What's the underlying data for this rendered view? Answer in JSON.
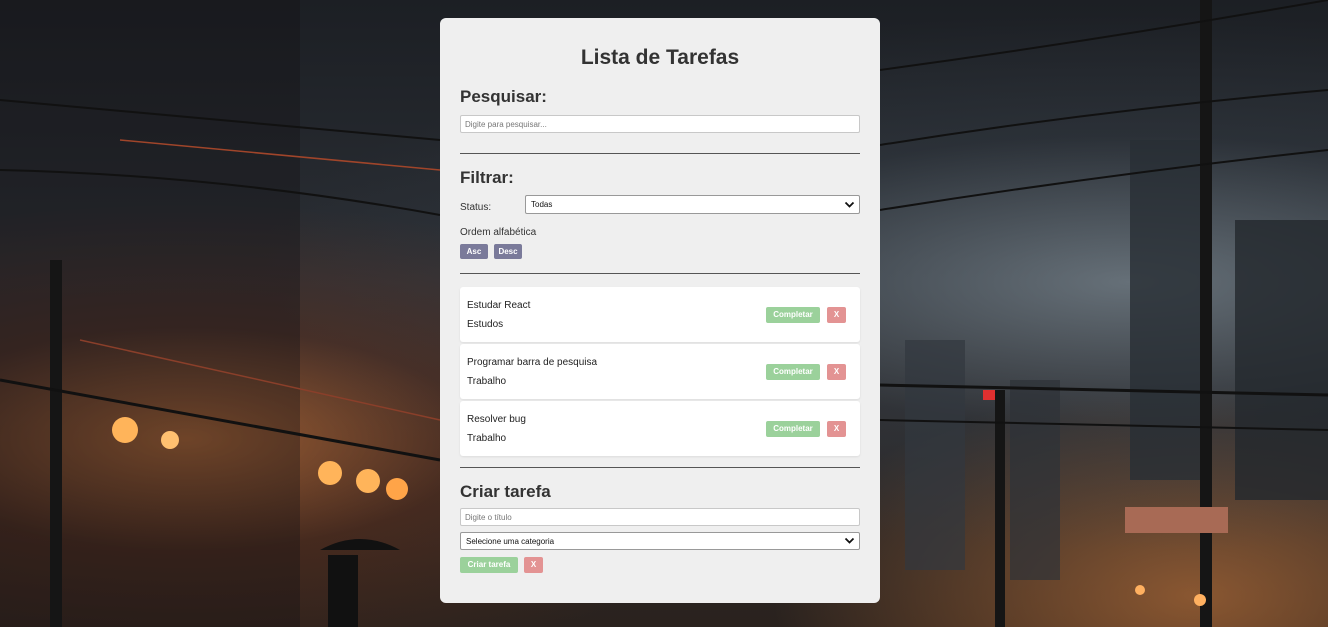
{
  "header": {
    "title": "Lista de Tarefas"
  },
  "search": {
    "heading": "Pesquisar:",
    "placeholder": "Digite para pesquisar..."
  },
  "filter": {
    "heading": "Filtrar:",
    "status_label": "Status:",
    "status_value": "Todas",
    "order_label": "Ordem alfabética",
    "asc_label": "Asc",
    "desc_label": "Desc"
  },
  "tasks": [
    {
      "title": "Estudar React",
      "category": "Estudos",
      "complete_label": "Completar",
      "remove_label": "X"
    },
    {
      "title": "Programar barra de pesquisa",
      "category": "Trabalho",
      "complete_label": "Completar",
      "remove_label": "X"
    },
    {
      "title": "Resolver bug",
      "category": "Trabalho",
      "complete_label": "Completar",
      "remove_label": "X"
    }
  ],
  "create": {
    "heading": "Criar tarefa",
    "title_placeholder": "Digite o título",
    "category_value": "Selecione uma categoria",
    "submit_label": "Criar tarefa",
    "cancel_label": "X"
  },
  "colors": {
    "card_bg": "#efefef",
    "sort_button": "#7a7a9a",
    "complete_button": "#9bd19b",
    "remove_button": "#e39393"
  },
  "icons": {
    "select_arrow": "chevron-down-icon"
  }
}
